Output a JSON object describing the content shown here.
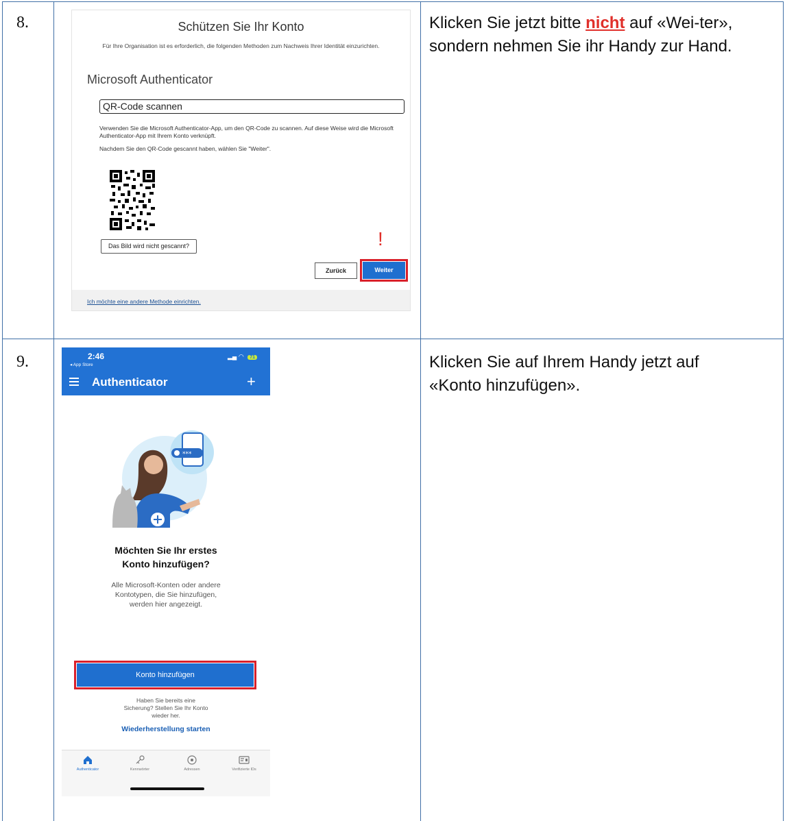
{
  "steps": [
    {
      "number": "8.",
      "instruction_before": "Klicken Sie jetzt bitte ",
      "instruction_emphasis": "nicht",
      "instruction_after": " auf «Wei-ter», sondern nehmen Sie ihr Handy zur Hand."
    },
    {
      "number": "9.",
      "instruction": "Klicken Sie auf Ihrem Handy jetzt auf «Konto hinzufügen»."
    }
  ],
  "web_screenshot": {
    "title": "Schützen Sie Ihr Konto",
    "subtitle": "Für Ihre Organisation ist es erforderlich, die folgenden Methoden zum Nachweis Ihrer Identität einzurichten.",
    "method_title": "Microsoft Authenticator",
    "section_label": "QR-Code scannen",
    "paragraph1": "Verwenden Sie die Microsoft Authenticator-App, um den QR-Code zu scannen. Auf diese Weise wird die Microsoft Authenticator-App mit Ihrem Konto verknüpft.",
    "paragraph2": "Nachdem Sie den QR-Code gescannt haben, wählen Sie \"Weiter\".",
    "image_not_scanned_button": "Das Bild wird nicht gescannt?",
    "exclamation": "!",
    "back_button": "Zurück",
    "next_button": "Weiter",
    "other_method_link": "Ich möchte eine andere Methode einrichten.",
    "highlight_color": "#d9202a",
    "primary_color": "#1f6fcf"
  },
  "phone_screenshot": {
    "status": {
      "time": "2:46",
      "back_app": "◂ App Store",
      "battery": "71"
    },
    "app_title": "Authenticator",
    "heading": "Möchten Sie Ihr erstes Konto hinzufügen?",
    "description": "Alle Microsoft-Konten oder andere Kontotypen, die Sie hinzufügen, werden hier angezeigt.",
    "add_account_button": "Konto hinzufügen",
    "backup_text": "Haben Sie bereits eine Sicherung? Stellen Sie Ihr Konto wieder her.",
    "restore_link": "Wiederherstellung starten",
    "tabs": [
      {
        "label": "Authenticator",
        "icon": "home-icon",
        "active": true
      },
      {
        "label": "Kennwörter",
        "icon": "key-icon",
        "active": false
      },
      {
        "label": "Adressen",
        "icon": "location-pin-icon",
        "active": false
      },
      {
        "label": "Verifizierte IDs",
        "icon": "id-card-icon",
        "active": false
      }
    ],
    "appbar_color": "#2272d4"
  }
}
